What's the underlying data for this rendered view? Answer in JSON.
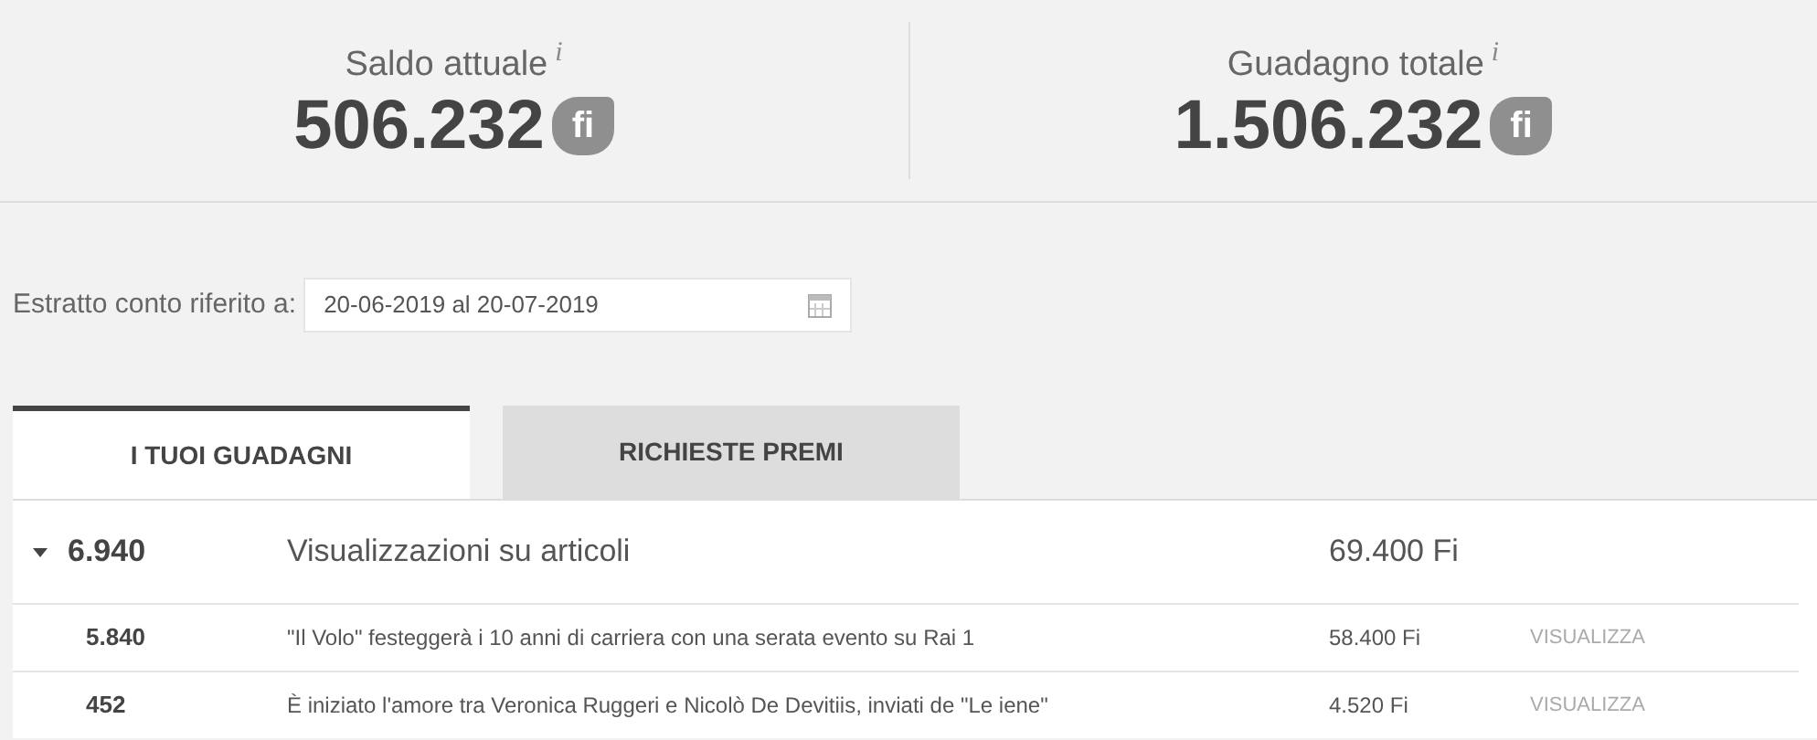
{
  "stats": [
    {
      "label": "Saldo attuale",
      "info": "i",
      "value": "506.232",
      "unit": "fi"
    },
    {
      "label": "Guadagno totale",
      "info": "i",
      "value": "1.506.232",
      "unit": "fi"
    }
  ],
  "statement": {
    "label": "Estratto conto riferito a:",
    "value": "20-06-2019 al 20-07-2019"
  },
  "tabs": [
    {
      "label": "I TUOI GUADAGNI",
      "selected": true
    },
    {
      "label": "RICHIESTE PREMI",
      "selected": false
    }
  ],
  "groups": [
    {
      "count": "6.940",
      "title": "Visualizzazioni su articoli",
      "amount": "69.400 Fi",
      "expanded": true,
      "rows": [
        {
          "count": "5.840",
          "title": "\"Il Volo\" festeggerà i 10 anni di carriera con una serata evento su Rai 1",
          "amount": "58.400 Fi",
          "action": "VISUALIZZA"
        },
        {
          "count": "452",
          "title": "È iniziato l'amore tra Veronica Ruggeri e Nicolò De Devitiis, inviati de \"Le iene\"",
          "amount": "4.520 Fi",
          "action": "VISUALIZZA"
        }
      ]
    }
  ]
}
